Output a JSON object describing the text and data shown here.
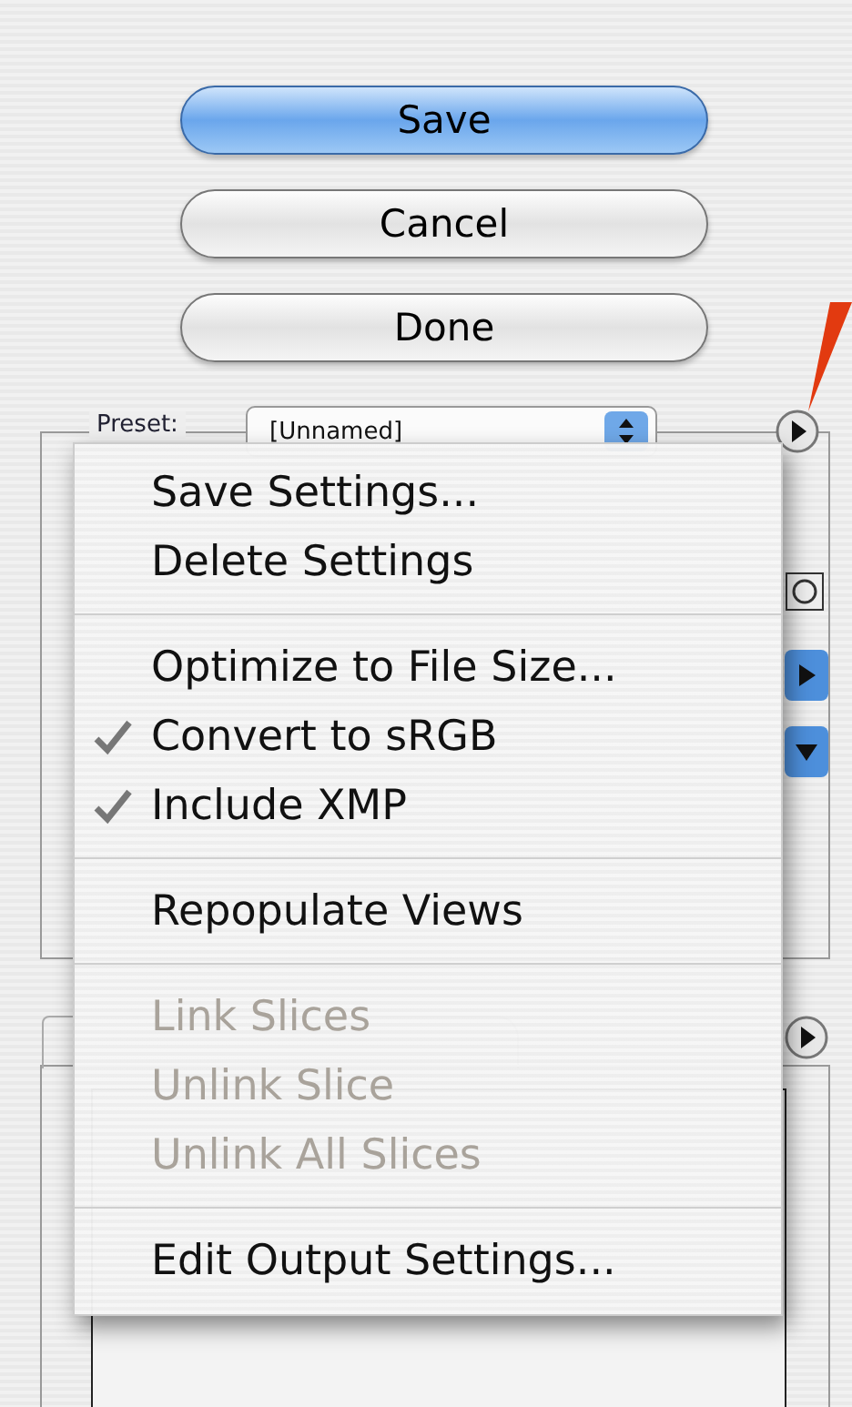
{
  "buttons": [
    {
      "label": "Save",
      "kind": "default"
    },
    {
      "label": "Cancel",
      "kind": "normal"
    },
    {
      "label": "Done",
      "kind": "normal"
    }
  ],
  "preset": {
    "label": "Preset:",
    "value": "[Unnamed]"
  },
  "menu": [
    {
      "kind": "item",
      "label": "Save Settings...",
      "checked": false,
      "disabled": false
    },
    {
      "kind": "item",
      "label": "Delete Settings",
      "checked": false,
      "disabled": false
    },
    {
      "kind": "separator"
    },
    {
      "kind": "item",
      "label": "Optimize to File Size...",
      "checked": false,
      "disabled": false
    },
    {
      "kind": "item",
      "label": "Convert to sRGB",
      "checked": true,
      "disabled": false
    },
    {
      "kind": "item",
      "label": "Include XMP",
      "checked": true,
      "disabled": false
    },
    {
      "kind": "separator"
    },
    {
      "kind": "item",
      "label": "Repopulate Views",
      "checked": false,
      "disabled": false
    },
    {
      "kind": "separator"
    },
    {
      "kind": "item",
      "label": "Link Slices",
      "checked": false,
      "disabled": true
    },
    {
      "kind": "item",
      "label": "Unlink Slice",
      "checked": false,
      "disabled": true
    },
    {
      "kind": "item",
      "label": "Unlink All Slices",
      "checked": false,
      "disabled": true
    },
    {
      "kind": "separator"
    },
    {
      "kind": "item",
      "label": "Edit Output Settings...",
      "checked": false,
      "disabled": false
    }
  ]
}
